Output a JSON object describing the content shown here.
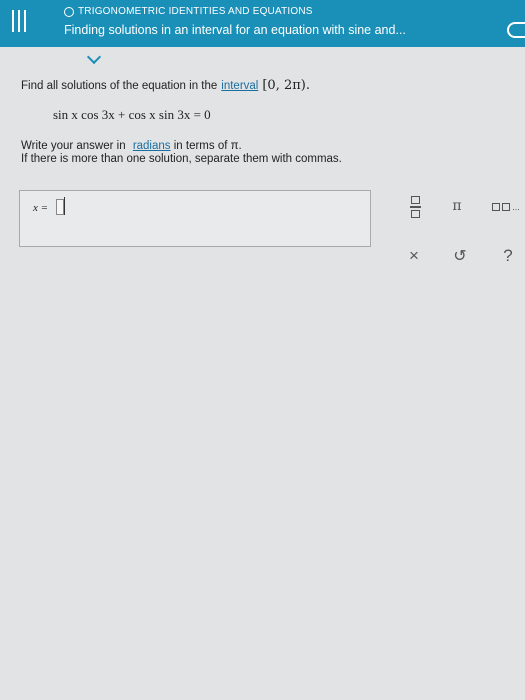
{
  "header": {
    "topic": "TRIGONOMETRIC IDENTITIES AND EQUATIONS",
    "title": "Finding solutions in an interval for an equation with sine and..."
  },
  "question": {
    "prompt": "Find all solutions of the equation in the",
    "interval_link": "interval",
    "interval": "[0, 2π).",
    "equation": "sin x cos 3x + cos x sin 3x = 0",
    "instruction_before_link": "Write your answer in",
    "radians_link": "radians",
    "instruction_after_link": "in terms of π.",
    "instruction2": "If there is more than one solution, separate them with commas."
  },
  "answer": {
    "label": "x ="
  },
  "toolbar": {
    "pi": "π",
    "clear": "×",
    "undo": "↺",
    "help": "?"
  }
}
